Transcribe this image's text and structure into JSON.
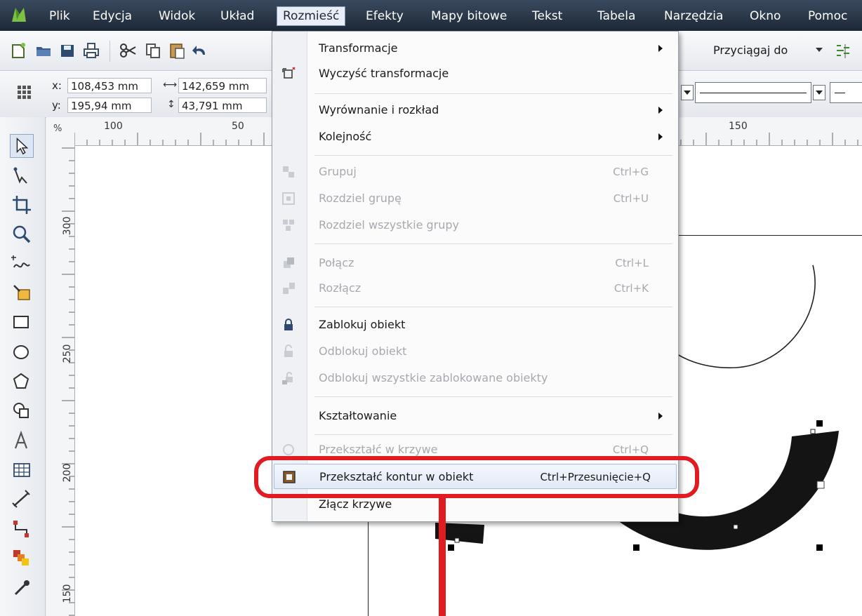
{
  "menubar": {
    "items": [
      {
        "label": "Plik"
      },
      {
        "label": "Edycja"
      },
      {
        "label": "Widok"
      },
      {
        "label": "Układ"
      },
      {
        "label": "Rozmieść"
      },
      {
        "label": "Efekty"
      },
      {
        "label": "Mapy bitowe"
      },
      {
        "label": "Tekst"
      },
      {
        "label": "Tabela"
      },
      {
        "label": "Narzędzia"
      },
      {
        "label": "Okno"
      },
      {
        "label": "Pomoc"
      }
    ],
    "active": "Rozmieść"
  },
  "toolbar": {
    "snap_label": "Przyciągaj do"
  },
  "propbar": {
    "x_label": "x:",
    "x_value": "108,453 mm",
    "y_label": "y:",
    "y_value": "195,94 mm",
    "width_value": "142,659 mm",
    "height_value": "43,791 mm"
  },
  "ruler": {
    "unit": "%",
    "h_ticks": [
      "100",
      "50",
      "150"
    ],
    "v_ticks": [
      "300",
      "250",
      "200",
      "150"
    ]
  },
  "menu": {
    "items": [
      {
        "label": "Transformacje",
        "shortcut": "",
        "submenu": true,
        "enabled": true
      },
      {
        "label": "Wyczyść transformacje",
        "shortcut": "",
        "submenu": false,
        "enabled": true
      },
      {
        "label": "Wyrównanie i rozkład",
        "shortcut": "",
        "submenu": true,
        "enabled": true
      },
      {
        "label": "Kolejność",
        "shortcut": "",
        "submenu": true,
        "enabled": true
      },
      {
        "label": "Grupuj",
        "shortcut": "Ctrl+G",
        "submenu": false,
        "enabled": false
      },
      {
        "label": "Rozdziel grupę",
        "shortcut": "Ctrl+U",
        "submenu": false,
        "enabled": false
      },
      {
        "label": "Rozdziel wszystkie grupy",
        "shortcut": "",
        "submenu": false,
        "enabled": false
      },
      {
        "label": "Połącz",
        "shortcut": "Ctrl+L",
        "submenu": false,
        "enabled": false
      },
      {
        "label": "Rozłącz",
        "shortcut": "Ctrl+K",
        "submenu": false,
        "enabled": false
      },
      {
        "label": "Zablokuj obiekt",
        "shortcut": "",
        "submenu": false,
        "enabled": true
      },
      {
        "label": "Odblokuj obiekt",
        "shortcut": "",
        "submenu": false,
        "enabled": false
      },
      {
        "label": "Odblokuj wszystkie zablokowane obiekty",
        "shortcut": "",
        "submenu": false,
        "enabled": false
      },
      {
        "label": "Kształtowanie",
        "shortcut": "",
        "submenu": true,
        "enabled": true
      },
      {
        "label": "Przekształć w krzywe",
        "shortcut": "Ctrl+Q",
        "submenu": false,
        "enabled": false
      },
      {
        "label": "Przekształć kontur w obiekt",
        "shortcut": "Ctrl+Przesunięcie+Q",
        "submenu": false,
        "enabled": true,
        "highlighted": true
      },
      {
        "label": "Złącz krzywe",
        "shortcut": "",
        "submenu": false,
        "enabled": true
      }
    ]
  },
  "colors": {
    "menubar": "#1d2836",
    "highlight": "#e2eaf6",
    "annotation": "#e11b22"
  }
}
